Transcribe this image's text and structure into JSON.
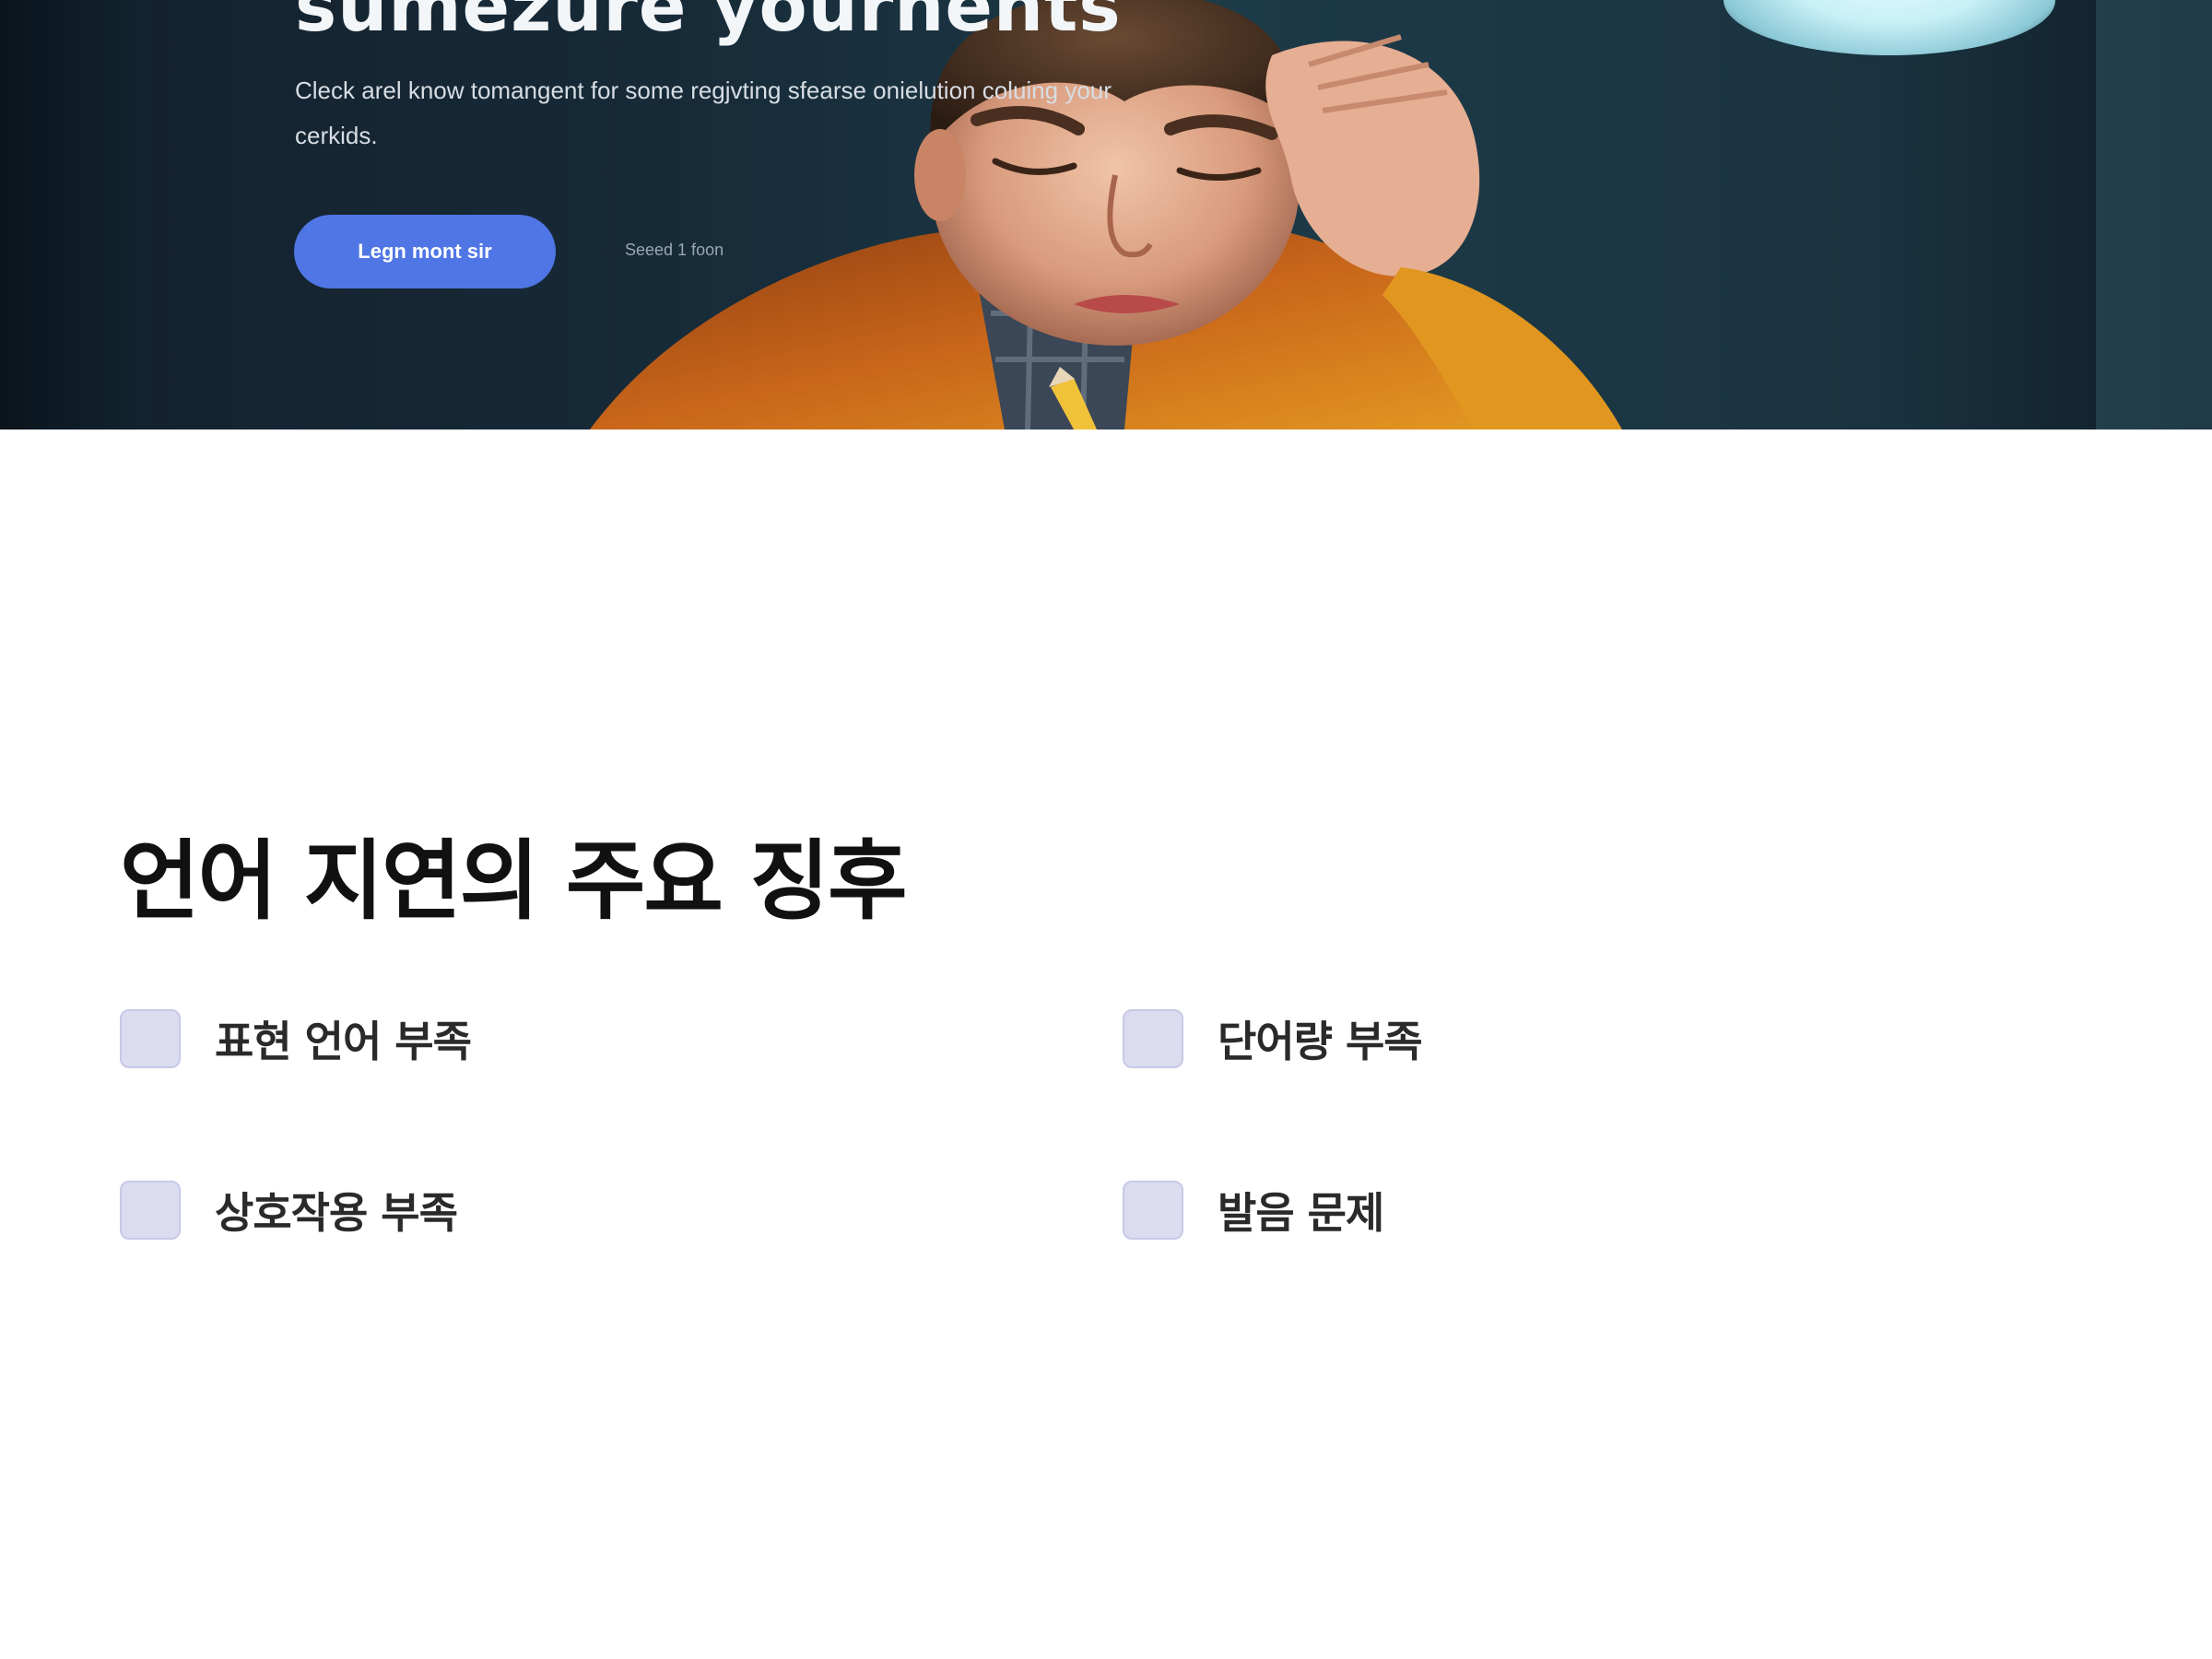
{
  "hero": {
    "headline": "sumezure yournents",
    "subtitle": "Cleck arel know tomangent for some regjvting sfearse onielution coluing your cerkids.",
    "cta_label": "Legn mont sir",
    "secondary_link": "Seeed 1 foon"
  },
  "section": {
    "title": "언어 지연의 주요 징후",
    "signs": [
      {
        "label": "표현 언어 부족",
        "checked": false
      },
      {
        "label": "단어량 부족",
        "checked": false
      },
      {
        "label": "상호작용 부족",
        "checked": false
      },
      {
        "label": "발음 문제",
        "checked": false
      }
    ]
  },
  "colors": {
    "accent": "#4f76e4",
    "checkbox_fill": "#dcdcf1",
    "checkbox_border": "#c7c9e6",
    "title_text": "#111111",
    "hero_bg": "#172a38"
  }
}
